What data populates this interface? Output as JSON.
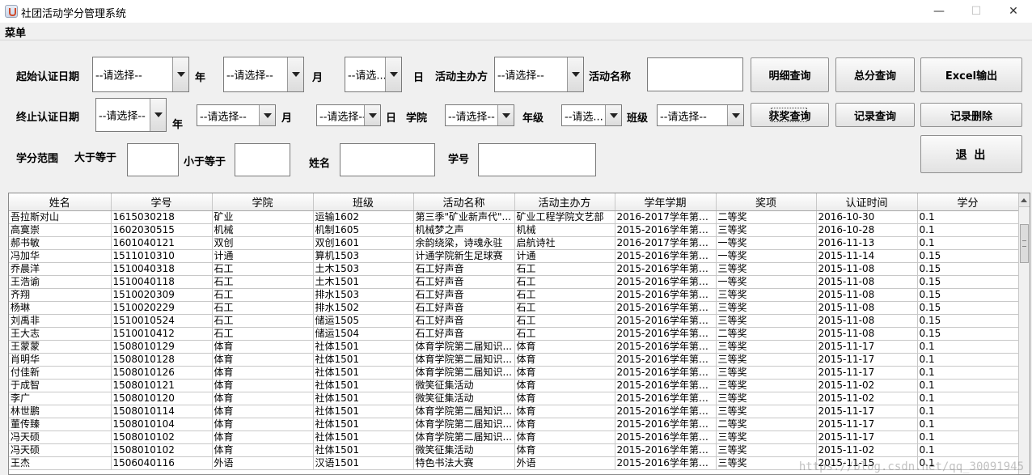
{
  "window": {
    "title": "社团活动学分管理系统",
    "minimize": "—",
    "maximize": "☐",
    "close": "✕"
  },
  "menu": {
    "label": "菜单"
  },
  "form": {
    "start_date_label": "起始认证日期",
    "end_date_label": "终止认证日期",
    "year_label": "年",
    "month_label": "月",
    "day_label": "日",
    "organizer_label": "活动主办方",
    "activity_name_label": "活动名称",
    "college_label": "学院",
    "grade_label": "年级",
    "class_label": "班级",
    "credit_range_label": "学分范围",
    "gte_label": "大于等于",
    "lte_label": "小于等于",
    "name_label": "姓名",
    "student_id_label": "学号",
    "combos": {
      "start_year": "--请选择--",
      "start_month": "--请选择--",
      "start_day": "--请选...",
      "organizer": "--请选择--",
      "end_year": "--请选择--",
      "end_month": "--请选择--",
      "end_day": "--请选择--",
      "college": "--请选择--",
      "grade": "--请选...",
      "class": "--请选择--"
    },
    "inputs": {
      "activity_name": "",
      "credit_min": "",
      "credit_max": "",
      "name": "",
      "student_id": ""
    }
  },
  "buttons": {
    "detail_query": "明细查询",
    "total_query": "总分查询",
    "excel_export": "Excel输出",
    "award_query": "获奖查询",
    "record_query": "记录查询",
    "record_delete": "记录删除",
    "exit": "退 出"
  },
  "table": {
    "columns": [
      "姓名",
      "学号",
      "学院",
      "班级",
      "活动名称",
      "活动主办方",
      "学年学期",
      "奖项",
      "认证时间",
      "学分"
    ],
    "rows": [
      [
        "吾拉斯对山",
        "1615030218",
        "矿业",
        "运输1602",
        "第三季\"矿业新声代\"...",
        "矿业工程学院文艺部",
        "2016-2017学年第1...",
        "二等奖",
        "2016-10-30",
        "0.1"
      ],
      [
        "高寞崇",
        "1602030515",
        "机械",
        "机制1605",
        "机械梦之声",
        "机械",
        "2015-2016学年第1...",
        "三等奖",
        "2016-10-28",
        "0.1"
      ],
      [
        "郝书敏",
        "1601040121",
        "双创",
        "双创1601",
        "余韵绕梁，诗魂永驻",
        "启航诗社",
        "2016-2017学年第1...",
        "一等奖",
        "2016-11-13",
        "0.1"
      ],
      [
        "冯加华",
        "1511010310",
        "计通",
        "算机1503",
        "计通学院新生足球赛",
        "计通",
        "2015-2016学年第1...",
        "一等奖",
        "2015-11-14",
        "0.15"
      ],
      [
        "乔晨洋",
        "1510040318",
        "石工",
        "土木1503",
        "石工好声音",
        "石工",
        "2015-2016学年第1...",
        "三等奖",
        "2015-11-08",
        "0.15"
      ],
      [
        "王浩谕",
        "1510040118",
        "石工",
        "土木1501",
        "石工好声音",
        "石工",
        "2015-2016学年第1...",
        "一等奖",
        "2015-11-08",
        "0.15"
      ],
      [
        "齐翔",
        "1510020309",
        "石工",
        "排水1503",
        "石工好声音",
        "石工",
        "2015-2016学年第1...",
        "三等奖",
        "2015-11-08",
        "0.15"
      ],
      [
        "杨琳",
        "1510020229",
        "石工",
        "排水1502",
        "石工好声音",
        "石工",
        "2015-2016学年第1...",
        "三等奖",
        "2015-11-08",
        "0.15"
      ],
      [
        "刘禹非",
        "1510010524",
        "石工",
        "储运1505",
        "石工好声音",
        "石工",
        "2015-2016学年第1...",
        "三等奖",
        "2015-11-08",
        "0.15"
      ],
      [
        "王大志",
        "1510010412",
        "石工",
        "储运1504",
        "石工好声音",
        "石工",
        "2015-2016学年第1...",
        "二等奖",
        "2015-11-08",
        "0.15"
      ],
      [
        "王蒙蒙",
        "1508010129",
        "体育",
        "社体1501",
        "体育学院第二届知识...",
        "体育",
        "2015-2016学年第1...",
        "三等奖",
        "2015-11-17",
        "0.1"
      ],
      [
        "肖明华",
        "1508010128",
        "体育",
        "社体1501",
        "体育学院第二届知识...",
        "体育",
        "2015-2016学年第1...",
        "三等奖",
        "2015-11-17",
        "0.1"
      ],
      [
        "付佳新",
        "1508010126",
        "体育",
        "社体1501",
        "体育学院第二届知识...",
        "体育",
        "2015-2016学年第1...",
        "三等奖",
        "2015-11-17",
        "0.1"
      ],
      [
        "于成智",
        "1508010121",
        "体育",
        "社体1501",
        "微笑征集活动",
        "体育",
        "2015-2016学年第1...",
        "三等奖",
        "2015-11-02",
        "0.1"
      ],
      [
        "李广",
        "1508010120",
        "体育",
        "社体1501",
        "微笑征集活动",
        "体育",
        "2015-2016学年第1...",
        "三等奖",
        "2015-11-02",
        "0.1"
      ],
      [
        "林世鹏",
        "1508010114",
        "体育",
        "社体1501",
        "体育学院第二届知识...",
        "体育",
        "2015-2016学年第1...",
        "三等奖",
        "2015-11-17",
        "0.1"
      ],
      [
        "董传臻",
        "1508010104",
        "体育",
        "社体1501",
        "体育学院第二届知识...",
        "体育",
        "2015-2016学年第1...",
        "二等奖",
        "2015-11-17",
        "0.1"
      ],
      [
        "冯天硕",
        "1508010102",
        "体育",
        "社体1501",
        "体育学院第二届知识...",
        "体育",
        "2015-2016学年第1...",
        "三等奖",
        "2015-11-17",
        "0.1"
      ],
      [
        "冯天硕",
        "1508010102",
        "体育",
        "社体1501",
        "微笑征集活动",
        "体育",
        "2015-2016学年第1...",
        "三等奖",
        "2015-11-02",
        "0.1"
      ],
      [
        "王杰",
        "1506040116",
        "外语",
        "汉语1501",
        "特色书法大赛",
        "外语",
        "2015-2016学年第1...",
        "三等奖",
        "2015-11-15",
        "0.1"
      ]
    ]
  },
  "watermark": "https://blog.csdn.net/qq_30091945"
}
